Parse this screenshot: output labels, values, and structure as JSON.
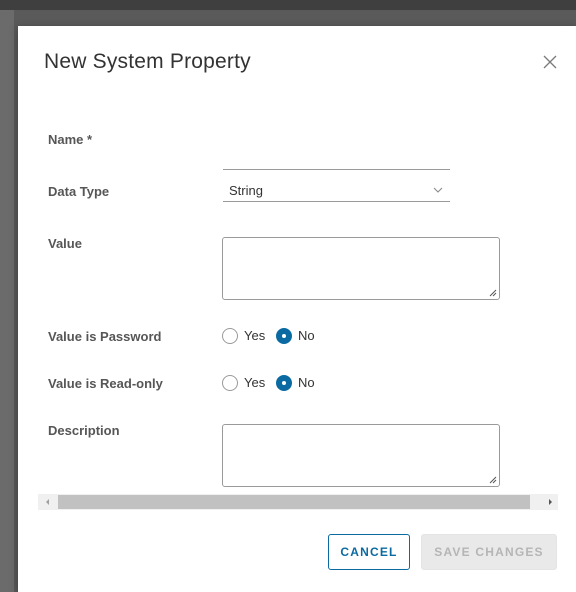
{
  "dialog": {
    "title": "New System Property",
    "close_icon": "close-icon"
  },
  "form": {
    "name": {
      "label": "Name *",
      "value": "",
      "placeholder": ""
    },
    "data_type": {
      "label": "Data Type",
      "selected": "String",
      "icon": "chevron-down-icon"
    },
    "value": {
      "label": "Value",
      "text": ""
    },
    "value_is_password": {
      "label": "Value is Password",
      "options": [
        "Yes",
        "No"
      ],
      "selected": "No"
    },
    "value_is_read_only": {
      "label": "Value is Read-only",
      "options": [
        "Yes",
        "No"
      ],
      "selected": "No"
    },
    "description": {
      "label": "Description",
      "text": ""
    }
  },
  "footer": {
    "cancel_label": "CANCEL",
    "save_label": "SAVE CHANGES"
  },
  "colors": {
    "accent": "#0b6aa2",
    "disabled_bg": "#e9e9e9",
    "disabled_text": "#b5b5b5"
  }
}
